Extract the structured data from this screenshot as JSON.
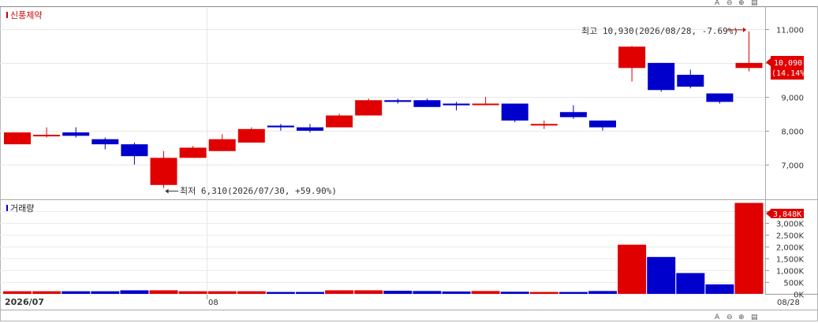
{
  "chart_data": [
    {
      "type": "candlestick",
      "title": "신풍제약",
      "ylim": [
        6000,
        11600
      ],
      "yticks": [
        {
          "value": 7000,
          "label": "7,000"
        },
        {
          "value": 8000,
          "label": "8,000"
        },
        {
          "value": 9000,
          "label": "9,000"
        },
        {
          "value": 10000,
          "label": "10,000"
        },
        {
          "value": 11000,
          "label": "11,000"
        }
      ],
      "candles": [
        {
          "open": 7600,
          "high": 7950,
          "low": 7600,
          "close": 7950
        },
        {
          "open": 7850,
          "high": 8100,
          "low": 7800,
          "close": 7880
        },
        {
          "open": 7950,
          "high": 8100,
          "low": 7800,
          "close": 7850
        },
        {
          "open": 7750,
          "high": 7800,
          "low": 7450,
          "close": 7600
        },
        {
          "open": 7600,
          "high": 7650,
          "low": 7000,
          "close": 7250
        },
        {
          "open": 6400,
          "high": 7400,
          "low": 6310,
          "close": 7200
        },
        {
          "open": 7200,
          "high": 7550,
          "low": 7200,
          "close": 7500
        },
        {
          "open": 7400,
          "high": 7900,
          "low": 7400,
          "close": 7750
        },
        {
          "open": 7650,
          "high": 8100,
          "low": 7650,
          "close": 8050
        },
        {
          "open": 8150,
          "high": 8200,
          "low": 8000,
          "close": 8100
        },
        {
          "open": 8100,
          "high": 8200,
          "low": 7950,
          "close": 8000
        },
        {
          "open": 8100,
          "high": 8500,
          "low": 8100,
          "close": 8450
        },
        {
          "open": 8450,
          "high": 8950,
          "low": 8450,
          "close": 8900
        },
        {
          "open": 8900,
          "high": 8950,
          "low": 8800,
          "close": 8850
        },
        {
          "open": 8900,
          "high": 8950,
          "low": 8700,
          "close": 8700
        },
        {
          "open": 8800,
          "high": 8850,
          "low": 8600,
          "close": 8750
        },
        {
          "open": 8800,
          "high": 9000,
          "low": 8750,
          "close": 8800
        },
        {
          "open": 8800,
          "high": 8800,
          "low": 8250,
          "close": 8300
        },
        {
          "open": 8200,
          "high": 8300,
          "low": 8050,
          "close": 8200
        },
        {
          "open": 8550,
          "high": 8750,
          "low": 8350,
          "close": 8400
        },
        {
          "open": 8300,
          "high": 8300,
          "low": 8000,
          "close": 8100
        },
        {
          "open": 9850,
          "high": 10500,
          "low": 9450,
          "close": 10480
        },
        {
          "open": 10000,
          "high": 10000,
          "low": 9150,
          "close": 9200
        },
        {
          "open": 9650,
          "high": 9800,
          "low": 9250,
          "close": 9300
        },
        {
          "open": 9100,
          "high": 9100,
          "low": 8800,
          "close": 8850
        },
        {
          "open": 9850,
          "high": 10930,
          "low": 9750,
          "close": 10000
        }
      ],
      "annotations": {
        "high": {
          "index": 25,
          "price": 10930,
          "label": "최고 10,930(2026/08/28, -7.69%)"
        },
        "low": {
          "index": 5,
          "price": 6310,
          "label": "최저 6,310(2026/07/30, +59.90%)"
        }
      },
      "last_price_badge": {
        "price": 10050,
        "value": "10,090",
        "change": "(14.14%)"
      },
      "colors": {
        "up": "#e00000",
        "down": "#0000cc",
        "badge": "#e00000"
      }
    },
    {
      "type": "bar",
      "title": "거래량",
      "ylim": [
        0,
        3900
      ],
      "yticks": [
        {
          "value": 0,
          "label": "0K"
        },
        {
          "value": 500,
          "label": "500K"
        },
        {
          "value": 1000,
          "label": "1,000K"
        },
        {
          "value": 1500,
          "label": "1,500K"
        },
        {
          "value": 2000,
          "label": "2,000K"
        },
        {
          "value": 2500,
          "label": "2,500K"
        },
        {
          "value": 3000,
          "label": "3,000K"
        },
        {
          "value": 3500,
          "label": "3,500K"
        }
      ],
      "values": [
        110,
        110,
        110,
        110,
        150,
        150,
        110,
        110,
        110,
        80,
        80,
        150,
        150,
        130,
        120,
        100,
        120,
        90,
        80,
        80,
        120,
        2080,
        1560,
        880,
        400,
        3848
      ],
      "last_volume_badge": {
        "value": 3848,
        "label": "3,848K"
      }
    }
  ],
  "x_axis": {
    "start_label": "2026/07",
    "mid_label": "08",
    "end_label": "08/28"
  },
  "controls": {
    "a": "A",
    "minus": "⊖",
    "plus": "⊕",
    "doc": "▤"
  }
}
